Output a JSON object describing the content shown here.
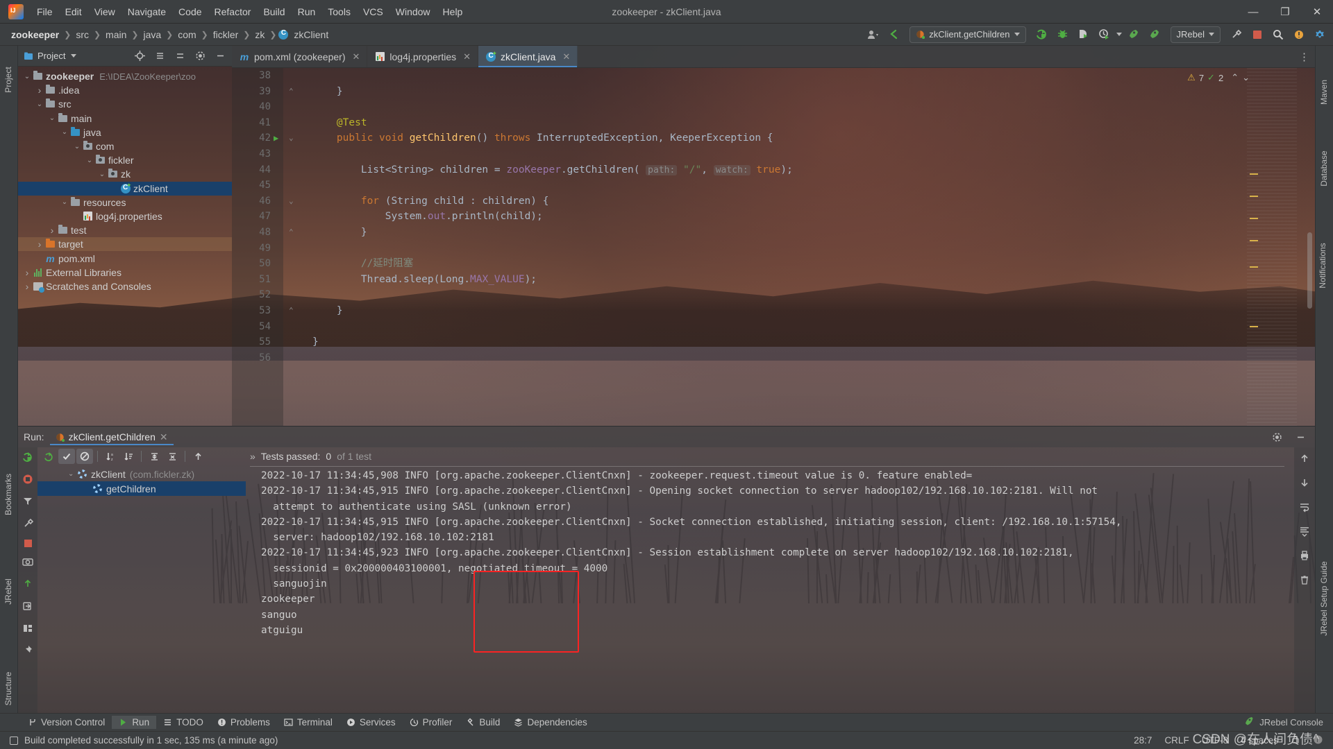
{
  "window": {
    "title": "zookeeper - zkClient.java"
  },
  "menu": {
    "items": [
      "File",
      "Edit",
      "View",
      "Navigate",
      "Code",
      "Refactor",
      "Build",
      "Run",
      "Tools",
      "VCS",
      "Window",
      "Help"
    ]
  },
  "window_controls": {
    "minimize": "—",
    "maximize": "❐",
    "close": "✕"
  },
  "breadcrumb": {
    "items": [
      "zookeeper",
      "src",
      "main",
      "java",
      "com",
      "fickler",
      "zk",
      "zkClient"
    ]
  },
  "toolbar": {
    "run_config": "zkClient.getChildren",
    "jrebel_label": "JRebel",
    "icons": [
      "profile-icon",
      "back-arrow-icon",
      "run-icon",
      "debug-icon",
      "run-coverage-icon",
      "profiler-icon",
      "stop-icon",
      "search-icon",
      "plugin-update-icon",
      "jrebel-run-icon",
      "jrebel-debug-icon",
      "settings-icon"
    ]
  },
  "project_panel": {
    "title": "Project",
    "tree": [
      {
        "label": "zookeeper",
        "path": "E:\\IDEA\\ZooKeeper\\zoo",
        "depth": 0,
        "arrow": "v",
        "icon": "module-folder-icon",
        "bold": true
      },
      {
        "label": ".idea",
        "depth": 1,
        "arrow": ">",
        "icon": "folder-icon"
      },
      {
        "label": "src",
        "depth": 1,
        "arrow": "v",
        "icon": "folder-icon"
      },
      {
        "label": "main",
        "depth": 2,
        "arrow": "v",
        "icon": "folder-icon"
      },
      {
        "label": "java",
        "depth": 3,
        "arrow": "v",
        "icon": "source-root-icon"
      },
      {
        "label": "com",
        "depth": 4,
        "arrow": "v",
        "icon": "package-icon"
      },
      {
        "label": "fickler",
        "depth": 5,
        "arrow": "v",
        "icon": "package-icon"
      },
      {
        "label": "zk",
        "depth": 6,
        "arrow": "v",
        "icon": "package-icon"
      },
      {
        "label": "zkClient",
        "depth": 7,
        "arrow": "",
        "icon": "java-class-icon",
        "selected": true
      },
      {
        "label": "resources",
        "depth": 3,
        "arrow": "v",
        "icon": "resource-folder-icon"
      },
      {
        "label": "log4j.properties",
        "depth": 4,
        "arrow": "",
        "icon": "properties-file-icon"
      },
      {
        "label": "test",
        "depth": 2,
        "arrow": ">",
        "icon": "folder-icon"
      },
      {
        "label": "target",
        "depth": 1,
        "arrow": ">",
        "icon": "excluded-folder-icon",
        "highlight": true
      },
      {
        "label": "pom.xml",
        "depth": 1,
        "arrow": "",
        "icon": "maven-file-icon"
      },
      {
        "label": "External Libraries",
        "depth": 0,
        "arrow": ">",
        "icon": "libraries-icon"
      },
      {
        "label": "Scratches and Consoles",
        "depth": 0,
        "arrow": ">",
        "icon": "scratches-icon"
      }
    ]
  },
  "editor": {
    "tabs": [
      {
        "label": "pom.xml (zookeeper)",
        "icon": "maven-file-icon",
        "active": false
      },
      {
        "label": "log4j.properties",
        "icon": "properties-file-icon",
        "active": false
      },
      {
        "label": "zkClient.java",
        "icon": "java-class-icon",
        "active": true
      }
    ],
    "inspection": {
      "warnings": "7",
      "weak_warnings": "2"
    },
    "lines": [
      {
        "no": "38",
        "segments": []
      },
      {
        "no": "39",
        "segments": [
          {
            "t": "    }",
            "c": "brk"
          }
        ],
        "fold": "end"
      },
      {
        "no": "40",
        "segments": []
      },
      {
        "no": "41",
        "segments": [
          {
            "t": "    @Test",
            "c": "ann"
          }
        ]
      },
      {
        "no": "42",
        "run": true,
        "fold": "start",
        "segments": [
          {
            "t": "    ",
            "c": "plain"
          },
          {
            "t": "public",
            "c": "k"
          },
          {
            "t": " ",
            "c": "plain"
          },
          {
            "t": "void",
            "c": "k"
          },
          {
            "t": " ",
            "c": "plain"
          },
          {
            "t": "getChildren",
            "c": "fn"
          },
          {
            "t": "() ",
            "c": "plain"
          },
          {
            "t": "throws",
            "c": "k"
          },
          {
            "t": " InterruptedException, KeeperException ",
            "c": "typ"
          },
          {
            "t": "{",
            "c": "brk"
          }
        ]
      },
      {
        "no": "43",
        "segments": []
      },
      {
        "no": "44",
        "segments": [
          {
            "t": "        List<String> children ",
            "c": "typ"
          },
          {
            "t": "= ",
            "c": "op"
          },
          {
            "t": "zooKeeper",
            "c": "fld"
          },
          {
            "t": ".getChildren( ",
            "c": "typ"
          },
          {
            "t": "path:",
            "c": "hint"
          },
          {
            "t": " ",
            "c": "plain"
          },
          {
            "t": "\"/\"",
            "c": "str"
          },
          {
            "t": ", ",
            "c": "typ"
          },
          {
            "t": "watch:",
            "c": "hint"
          },
          {
            "t": " ",
            "c": "plain"
          },
          {
            "t": "true",
            "c": "k"
          },
          {
            "t": ");",
            "c": "typ"
          }
        ]
      },
      {
        "no": "45",
        "segments": []
      },
      {
        "no": "46",
        "fold": "start",
        "segments": [
          {
            "t": "        ",
            "c": "plain"
          },
          {
            "t": "for",
            "c": "k"
          },
          {
            "t": " (String child : children) ",
            "c": "typ"
          },
          {
            "t": "{",
            "c": "brk"
          }
        ]
      },
      {
        "no": "47",
        "segments": [
          {
            "t": "            System.",
            "c": "typ"
          },
          {
            "t": "out",
            "c": "fld"
          },
          {
            "t": ".println(child);",
            "c": "typ"
          }
        ]
      },
      {
        "no": "48",
        "fold": "end",
        "segments": [
          {
            "t": "        }",
            "c": "brk"
          }
        ]
      },
      {
        "no": "49",
        "segments": []
      },
      {
        "no": "50",
        "segments": [
          {
            "t": "        //延时阻塞",
            "c": "cmt"
          }
        ]
      },
      {
        "no": "51",
        "segments": [
          {
            "t": "        Thread.",
            "c": "typ"
          },
          {
            "t": "sleep",
            "c": "typ"
          },
          {
            "t": "(Long.",
            "c": "typ"
          },
          {
            "t": "MAX_VALUE",
            "c": "fld"
          },
          {
            "t": ");",
            "c": "typ"
          }
        ]
      },
      {
        "no": "52",
        "segments": []
      },
      {
        "no": "53",
        "fold": "end",
        "segments": [
          {
            "t": "    }",
            "c": "brk"
          }
        ]
      },
      {
        "no": "54",
        "segments": []
      },
      {
        "no": "55",
        "segments": [
          {
            "t": "}",
            "c": "brk"
          }
        ]
      },
      {
        "no": "56",
        "segments": []
      }
    ]
  },
  "run_window": {
    "label": "Run:",
    "tab_label": "zkClient.getChildren",
    "toolbar_icons": [
      "rerun-icon",
      "show-passed-icon",
      "show-ignored-icon",
      "sort-alphabetically-icon",
      "sort-by-duration-icon",
      "expand-all-icon",
      "collapse-all-icon",
      "prev-failed-icon",
      "next-test-icon"
    ],
    "tests_status_prefix": "Tests passed:",
    "tests_status_value": "0",
    "tests_status_suffix": "of 1 test",
    "tree": [
      {
        "label": "zkClient",
        "suffix": "(com.fickler.zk)",
        "depth": 0,
        "arrow": "v",
        "icon": "running-test-icon"
      },
      {
        "label": "getChildren",
        "suffix": "",
        "depth": 1,
        "arrow": "",
        "icon": "running-test-icon",
        "selected": true
      }
    ],
    "console_lines": [
      "2022-10-17 11:34:45,908 INFO [org.apache.zookeeper.ClientCnxn] - zookeeper.request.timeout value is 0. feature enabled=",
      "2022-10-17 11:34:45,915 INFO [org.apache.zookeeper.ClientCnxn] - Opening socket connection to server hadoop102/192.168.10.102:2181. Will not",
      "  attempt to authenticate using SASL (unknown error)",
      "2022-10-17 11:34:45,915 INFO [org.apache.zookeeper.ClientCnxn] - Socket connection established, initiating session, client: /192.168.10.1:57154,",
      "  server: hadoop102/192.168.10.102:2181",
      "2022-10-17 11:34:45,923 INFO [org.apache.zookeeper.ClientCnxn] - Session establishment complete on server hadoop102/192.168.10.102:2181,",
      "  sessionid = 0x200000403100001, negotiated timeout = 4000",
      "  sanguojin",
      "zookeeper",
      "sanguo",
      "atguigu"
    ],
    "highlight_color": "#fb2323"
  },
  "bottom_toolwindows": [
    {
      "label": "Version Control",
      "icon": "branch-icon",
      "active": false
    },
    {
      "label": "Run",
      "icon": "run-icon",
      "active": true
    },
    {
      "label": "TODO",
      "icon": "todo-icon",
      "active": false
    },
    {
      "label": "Problems",
      "icon": "problems-icon",
      "active": false
    },
    {
      "label": "Terminal",
      "icon": "terminal-icon",
      "active": false
    },
    {
      "label": "Services",
      "icon": "services-icon",
      "active": false
    },
    {
      "label": "Profiler",
      "icon": "profiler-icon",
      "active": false
    },
    {
      "label": "Build",
      "icon": "build-icon",
      "active": false
    },
    {
      "label": "Dependencies",
      "icon": "dependencies-icon",
      "active": false
    }
  ],
  "jrebel_console": {
    "label": "JRebel Console",
    "icon": "jrebel-icon"
  },
  "statusbar": {
    "build_message": "Build completed successfully in 1 sec, 135 ms (a minute ago)",
    "caret": "28:7",
    "line_separator": "CRLF",
    "encoding": "UTF-8",
    "indent": "4 spaces"
  },
  "side_strips": {
    "left": [
      "Project",
      "Bookmarks",
      "JRebel",
      "Structure"
    ],
    "right": [
      "Maven",
      "Database",
      "Notifications",
      "JRebel Setup Guide"
    ]
  },
  "watermark": "CSDN @在人间负债^"
}
